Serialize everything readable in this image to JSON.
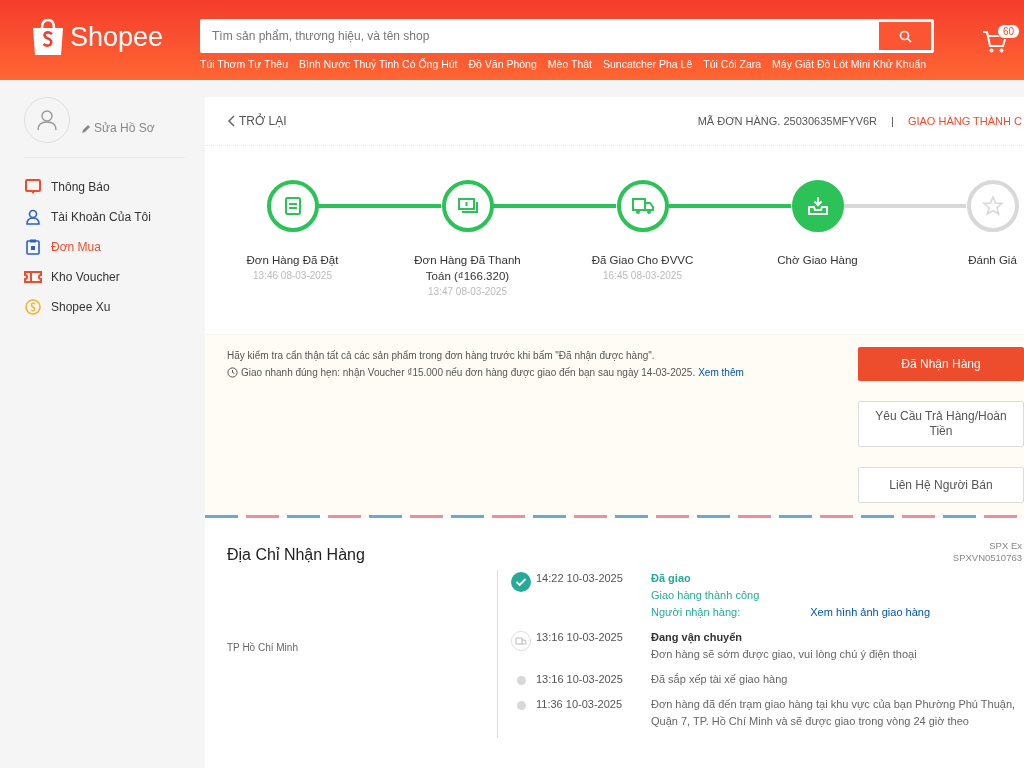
{
  "header": {
    "logo": "Shopee",
    "search": {
      "placeholder": "Tìm sản phẩm, thương hiệu, và tên shop"
    },
    "keywords": [
      "Túi Thơm Tự Thêu",
      "Bình Nước Thuỷ Tinh Có Ống Hút",
      "Đồ Văn Phòng",
      "Mèo Thật",
      "Suncatcher Pha Lê",
      "Túi Cói Zara",
      "Máy Giặt Đồ Lót Mini Khử Khuẩn"
    ],
    "cart_count": "60"
  },
  "sidebar": {
    "edit_profile": "Sửa Hồ Sơ",
    "items": [
      {
        "label": "Thông Báo",
        "kind": "bell",
        "color": "#ee4d2d",
        "selected": false
      },
      {
        "label": "Tài Khoản Của Tôi",
        "kind": "user",
        "color": "#2d5fc4",
        "selected": false
      },
      {
        "label": "Đơn Mua",
        "kind": "clipboard",
        "color": "#2d5fc4",
        "selected": true
      },
      {
        "label": "Kho Voucher",
        "kind": "voucher",
        "color": "#ee4d2d",
        "selected": false
      },
      {
        "label": "Shopee Xu",
        "kind": "coin",
        "color": "#f1b434",
        "selected": false
      }
    ]
  },
  "order": {
    "back": "TRỞ LẠI",
    "order_id": "MÃ ĐƠN HÀNG. 25030635MFYV6R",
    "separator": "|",
    "status": "GIAO HÀNG THÀNH C",
    "steps": [
      {
        "label": "Đơn Hàng Đã Đặt",
        "time": "13:46 08-03-2025",
        "done": true,
        "active": false
      },
      {
        "label": "Đơn Hàng Đã Thanh Toán (₫166.320)",
        "time": "13:47 08-03-2025",
        "done": true,
        "active": false
      },
      {
        "label": "Đã Giao Cho ĐVVC",
        "time": "16:45 08-03-2025",
        "done": true,
        "active": false
      },
      {
        "label": "Chờ Giao Hàng",
        "done": true,
        "active": true
      },
      {
        "label": "Đánh Giá",
        "done": false,
        "active": false
      }
    ],
    "notice": "Hãy kiểm tra cẩn thận tất cả các sản phẩm trong đơn hàng trước khi bấm \"Đã nhận được hàng\".",
    "guarantee": "Giao nhanh đúng hẹn: nhận Voucher ₫15.000 nếu đơn hàng được giao đến bạn sau ngày 14-03-2025.",
    "guarantee_link": "Xem thêm",
    "buttons": [
      {
        "label": "Đã Nhận Hàng",
        "kind": "primary"
      },
      {
        "label": "Yêu Cầu Trả Hàng/Hoàn Tiền",
        "kind": "secondary"
      },
      {
        "label": "Liên Hệ Người Bán",
        "kind": "secondary"
      }
    ]
  },
  "address": {
    "title": "Địa Chỉ Nhận Hàng",
    "carrier": "SPX Ex",
    "tracking": "SPXVN0510763",
    "city": "TP Hồ Chí Minh"
  },
  "timeline": [
    {
      "time": "14:22 10-03-2025",
      "kind": "delivered",
      "title": "Đã giao",
      "lines": [
        "Giao hàng thành công"
      ],
      "recipient_label": "Người nhận hàng:",
      "link": "Xem hình ảnh giao hàng"
    },
    {
      "time": "13:16 10-03-2025",
      "kind": "transit",
      "title": "Đang vận chuyển",
      "lines": [
        "Đơn hàng sẽ sớm được giao, vui lòng chú ý điện thoại"
      ]
    },
    {
      "time": "13:16 10-03-2025",
      "kind": "minor",
      "lines": [
        "Đã sắp xếp tài xế giao hàng"
      ]
    },
    {
      "time": "11:36 10-03-2025",
      "kind": "minor",
      "lines": [
        "Đơn hàng đã đến trạm giao hàng tại khu vực của bạn Phường Phú Thuận, Quận 7, TP. Hồ Chí Minh và sẽ được giao trong vòng 24 giờ theo"
      ]
    }
  ]
}
